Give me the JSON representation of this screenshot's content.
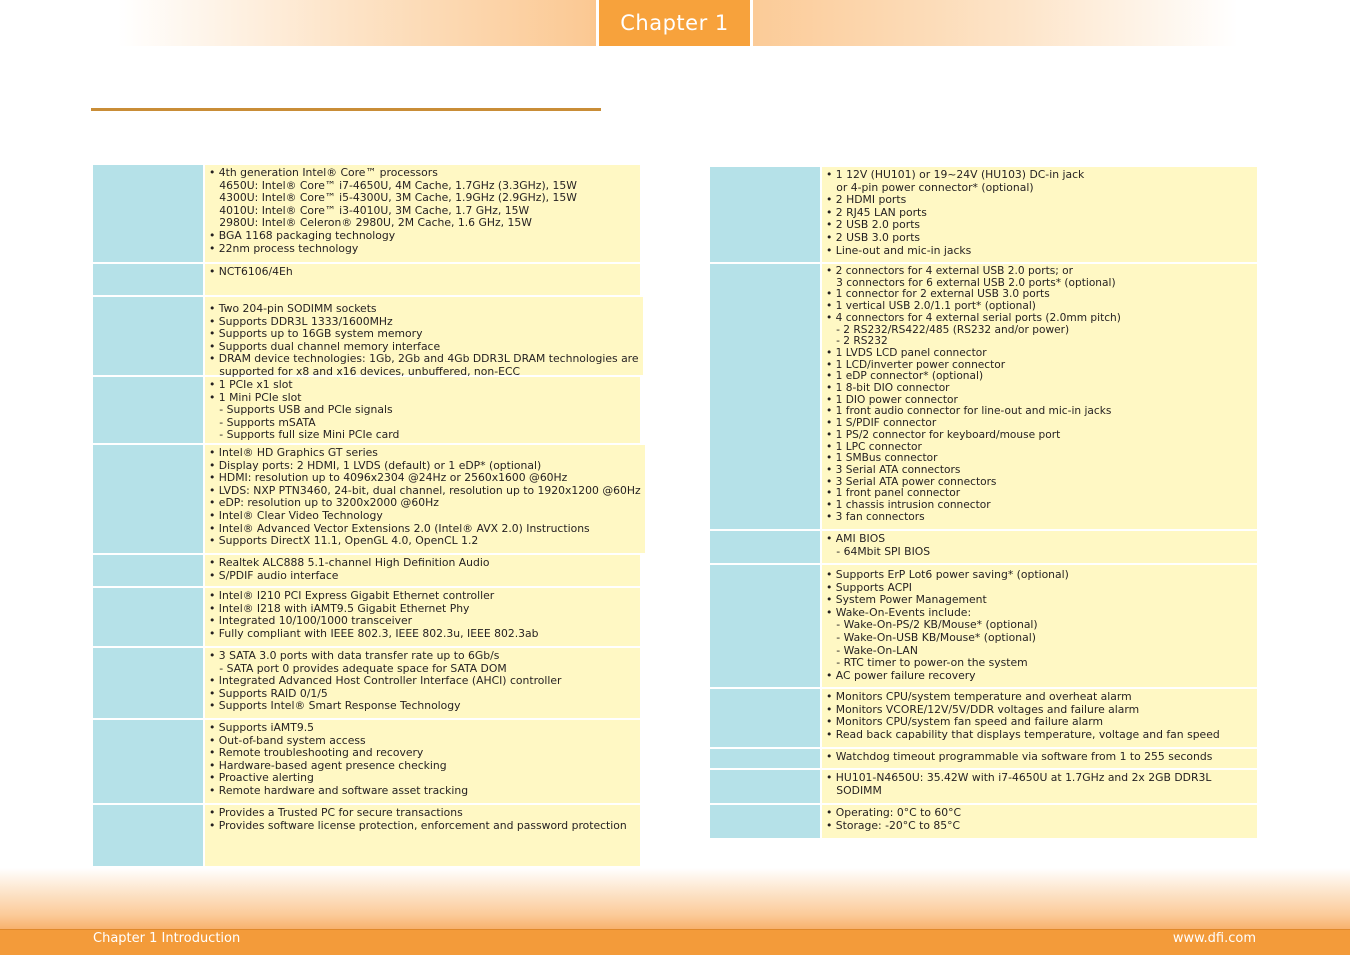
{
  "header": {
    "chapter_tab": "Chapter 1"
  },
  "left_table": {
    "rows": [
      {
        "text": "• 4th generation Intel® Core™ processors\n   4650U: Intel® Core™ i7-4650U, 4M Cache, 1.7GHz (3.3GHz), 15W\n   4300U: Intel® Core™ i5-4300U, 3M Cache, 1.9GHz (2.9GHz), 15W\n   4010U: Intel® Core™ i3-4010U, 3M Cache, 1.7 GHz, 15W\n   2980U: Intel® Celeron® 2980U, 2M Cache, 1.6 GHz, 15W\n• BGA 1168 packaging technology\n• 22nm process technology"
      },
      {
        "text": "• NCT6106/4Eh"
      },
      {
        "text": "• Two 204-pin SODIMM sockets\n• Supports DDR3L 1333/1600MHz\n• Supports up to 16GB system memory\n• Supports dual channel memory interface\n• DRAM device technologies: 1Gb, 2Gb and 4Gb DDR3L DRAM technologies are\n   supported for x8 and x16 devices, unbuffered, non-ECC"
      },
      {
        "text": "• 1 PCIe x1 slot\n• 1 Mini PCIe slot\n   - Supports USB and PCIe signals\n   - Supports mSATA\n   - Supports full size Mini PCIe card"
      },
      {
        "text": "• Intel® HD Graphics GT series\n• Display ports: 2 HDMI, 1 LVDS (default) or 1 eDP* (optional)\n• HDMI: resolution up to 4096x2304 @24Hz or 2560x1600 @60Hz\n• LVDS: NXP PTN3460, 24-bit, dual channel, resolution up to 1920x1200 @60Hz\n• eDP: resolution up to 3200x2000 @60Hz\n• Intel® Clear Video Technology\n• Intel® Advanced Vector Extensions 2.0 (Intel® AVX 2.0) Instructions\n• Supports DirectX 11.1, OpenGL 4.0, OpenCL 1.2"
      },
      {
        "text": "• Realtek ALC888 5.1-channel High Definition Audio\n• S/PDIF audio interface"
      },
      {
        "text": "• Intel® I210 PCI Express Gigabit Ethernet controller\n• Intel® I218 with iAMT9.5 Gigabit Ethernet Phy\n• Integrated 10/100/1000 transceiver\n• Fully compliant with IEEE 802.3, IEEE 802.3u, IEEE 802.3ab"
      },
      {
        "text": "• 3 SATA 3.0 ports with data transfer rate up to 6Gb/s\n   - SATA port 0 provides adequate space for SATA DOM\n• Integrated Advanced Host Controller Interface (AHCI) controller\n• Supports RAID 0/1/5\n• Supports Intel® Smart Response Technology"
      },
      {
        "text": "• Supports iAMT9.5\n• Out-of-band system access\n• Remote troubleshooting and recovery\n• Hardware-based agent presence checking\n• Proactive alerting\n• Remote hardware and software asset tracking"
      },
      {
        "text": "• Provides a Trusted PC for secure transactions\n• Provides software license protection, enforcement and password protection"
      }
    ]
  },
  "right_table": {
    "rows": [
      {
        "text": "• 1 12V (HU101) or 19~24V (HU103) DC-in jack\n   or 4-pin power connector* (optional)\n• 2 HDMI ports\n• 2 RJ45 LAN ports\n• 2 USB 2.0 ports\n• 2 USB 3.0 ports\n• Line-out and mic-in jacks"
      },
      {
        "text": "• 2 connectors for 4 external USB 2.0 ports; or\n   3 connectors for 6 external USB 2.0 ports* (optional)\n• 1 connector for 2 external USB 3.0 ports\n• 1 vertical USB 2.0/1.1 port* (optional)\n• 4 connectors for 4 external serial ports (2.0mm pitch)\n   - 2 RS232/RS422/485 (RS232 and/or power)\n   - 2 RS232\n• 1 LVDS LCD panel connector\n• 1 LCD/inverter power connector\n• 1 eDP connector* (optional)\n• 1 8-bit DIO connector\n• 1 DIO power connector\n• 1 front audio connector for line-out and mic-in jacks\n• 1 S/PDIF connector\n• 1 PS/2 connector for keyboard/mouse port\n• 1 LPC connector\n• 1 SMBus connector\n• 3 Serial ATA connectors\n• 3 Serial ATA power connectors\n• 1 front panel connector\n• 1 chassis intrusion connector\n• 3 fan connectors"
      },
      {
        "text": "• AMI BIOS\n   - 64Mbit SPI BIOS"
      },
      {
        "text": "• Supports ErP Lot6 power saving* (optional)\n• Supports ACPI\n• System Power Management\n• Wake-On-Events include:\n   - Wake-On-PS/2 KB/Mouse* (optional)\n   - Wake-On-USB KB/Mouse* (optional)\n   - Wake-On-LAN\n   - RTC timer to power-on the system\n• AC power failure recovery"
      },
      {
        "text": "• Monitors CPU/system temperature and overheat alarm\n• Monitors VCORE/12V/5V/DDR voltages and failure alarm\n• Monitors CPU/system fan speed and failure alarm\n• Read back capability that displays temperature, voltage and fan speed"
      },
      {
        "text": "• Watchdog timeout programmable via software from 1 to 255 seconds"
      },
      {
        "text": "• HU101-N4650U: 35.42W with i7-4650U at 1.7GHz and 2x 2GB DDR3L\n   SODIMM"
      },
      {
        "text": "• Operating: 0°C to 60°C\n• Storage: -20°C to 85°C"
      }
    ]
  },
  "footer": {
    "left": "Chapter 1 Introduction",
    "right": "www.dfi.com"
  }
}
